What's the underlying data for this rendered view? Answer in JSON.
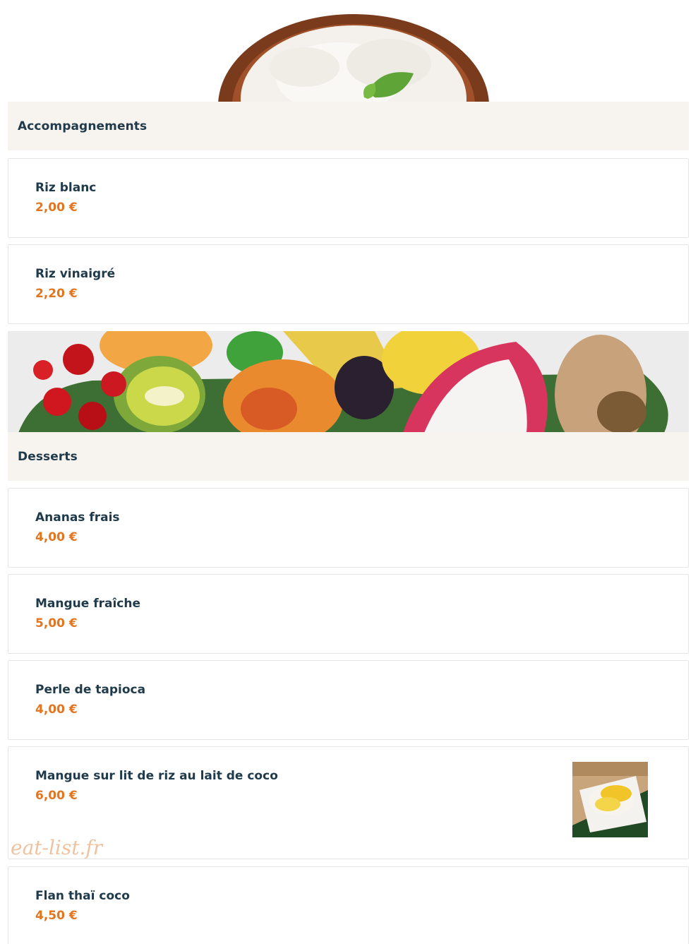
{
  "sections": [
    {
      "title": "Accompagnements",
      "items": [
        {
          "name": "Riz blanc",
          "price": "2,00 €"
        },
        {
          "name": "Riz vinaigré",
          "price": "2,20 €"
        }
      ]
    },
    {
      "title": "Desserts",
      "items": [
        {
          "name": "Ananas frais",
          "price": "4,00 €"
        },
        {
          "name": "Mangue fraîche",
          "price": "5,00 €"
        },
        {
          "name": "Perle de tapioca",
          "price": "4,00 €"
        },
        {
          "name": "Mangue sur lit de riz au lait de coco",
          "price": "6,00 €"
        },
        {
          "name": "Flan thaï coco",
          "price": "4,50 €"
        }
      ]
    }
  ],
  "watermark": "eat-list.fr",
  "colors": {
    "section_bg": "#f7f3ef",
    "title_text": "#1f3a4a",
    "price_text": "#e2751e",
    "card_border": "#e8e6e3"
  }
}
